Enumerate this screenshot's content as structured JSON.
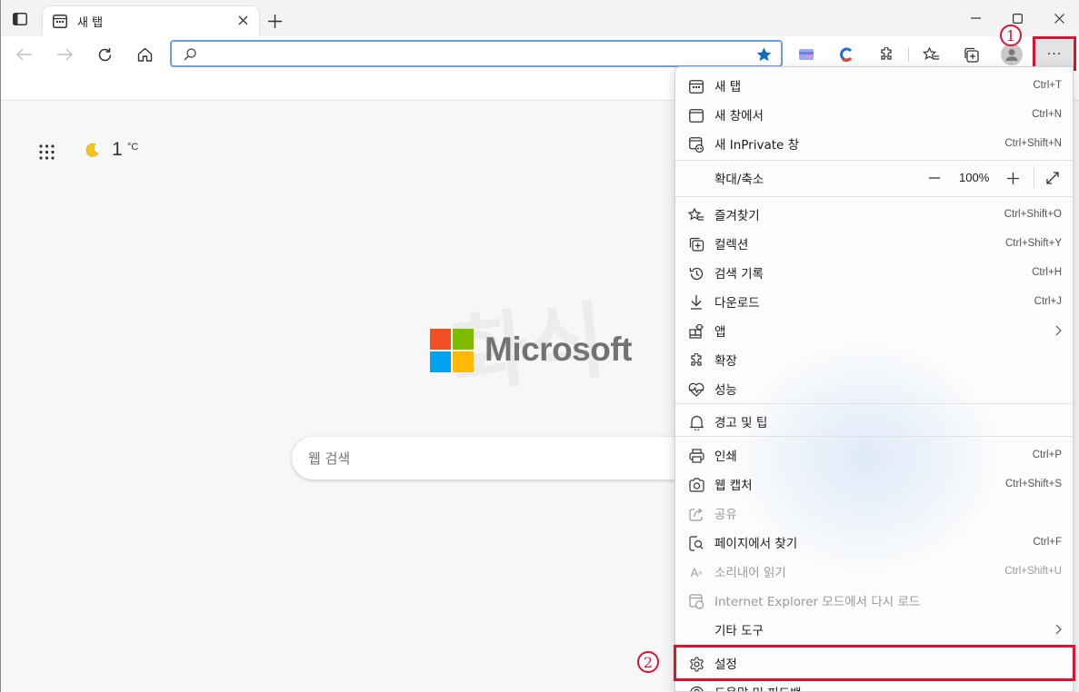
{
  "tab": {
    "title": "새 탭"
  },
  "address_bar": {
    "value": "",
    "placeholder": ""
  },
  "weather": {
    "temp": "1",
    "unit": "°C"
  },
  "logo": {
    "text": "Microsoft"
  },
  "search": {
    "placeholder": "웹 검색"
  },
  "annotations": {
    "one": "1",
    "two": "2"
  },
  "menu": {
    "zoom": {
      "label": "확대/축소",
      "value": "100%"
    },
    "items": [
      {
        "label": "새 탭",
        "shortcut": "Ctrl+T",
        "icon": "new-tab-icon"
      },
      {
        "label": "새 창에서",
        "shortcut": "Ctrl+N",
        "icon": "new-window-icon"
      },
      {
        "label": "새 InPrivate 창",
        "shortcut": "Ctrl+Shift+N",
        "icon": "inprivate-icon"
      },
      {
        "label": "즐겨찾기",
        "shortcut": "Ctrl+Shift+O",
        "icon": "favorites-icon"
      },
      {
        "label": "컬렉션",
        "shortcut": "Ctrl+Shift+Y",
        "icon": "collections-icon"
      },
      {
        "label": "검색 기록",
        "shortcut": "Ctrl+H",
        "icon": "history-icon"
      },
      {
        "label": "다운로드",
        "shortcut": "Ctrl+J",
        "icon": "download-icon"
      },
      {
        "label": "앱",
        "shortcut": "",
        "icon": "apps-icon"
      },
      {
        "label": "확장",
        "shortcut": "",
        "icon": "extensions-icon"
      },
      {
        "label": "성능",
        "shortcut": "",
        "icon": "performance-icon"
      },
      {
        "label": "경고 및 팁",
        "shortcut": "",
        "icon": "bell-icon"
      },
      {
        "label": "인쇄",
        "shortcut": "Ctrl+P",
        "icon": "print-icon"
      },
      {
        "label": "웹 캡처",
        "shortcut": "Ctrl+Shift+S",
        "icon": "web-capture-icon"
      },
      {
        "label": "공유",
        "shortcut": "",
        "icon": "share-icon"
      },
      {
        "label": "페이지에서 찾기",
        "shortcut": "Ctrl+F",
        "icon": "find-icon"
      },
      {
        "label": "소리내어 읽기",
        "shortcut": "Ctrl+Shift+U",
        "icon": "read-aloud-icon"
      },
      {
        "label": "Internet Explorer 모드에서 다시 로드",
        "shortcut": "",
        "icon": "ie-mode-icon"
      },
      {
        "label": "기타 도구",
        "shortcut": "",
        "icon": ""
      },
      {
        "label": "설정",
        "shortcut": "",
        "icon": "settings-icon"
      },
      {
        "label": "도움말 및 피드백",
        "shortcut": "",
        "icon": "help-icon"
      }
    ]
  },
  "colors": {
    "highlight": "#e0102f",
    "accent": "#0f6cbd",
    "ms_red": "#f25022",
    "ms_green": "#7fba00",
    "ms_blue": "#00a4ef",
    "ms_yellow": "#ffb900"
  }
}
